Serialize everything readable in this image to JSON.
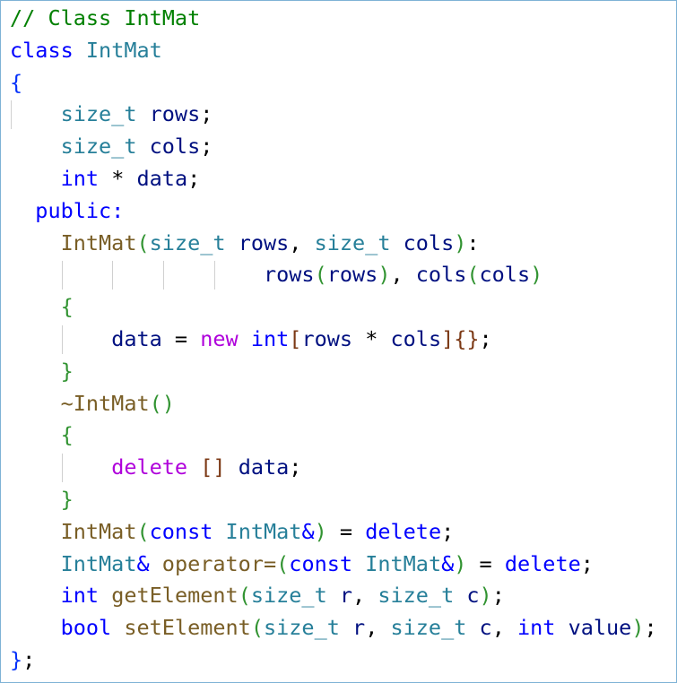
{
  "code_lines": [
    {
      "indent": 0,
      "guides": [],
      "tokens": [
        {
          "t": "// Class IntMat",
          "c": "comment"
        }
      ]
    },
    {
      "indent": 0,
      "guides": [],
      "tokens": [
        {
          "t": "class",
          "c": "kw"
        },
        {
          "t": " ",
          "c": "op"
        },
        {
          "t": "IntMat",
          "c": "type"
        }
      ]
    },
    {
      "indent": 0,
      "guides": [],
      "tokens": [
        {
          "t": "{",
          "c": "br1"
        }
      ]
    },
    {
      "indent": 4,
      "guides": [
        0
      ],
      "tokens": [
        {
          "t": "size_t",
          "c": "type"
        },
        {
          "t": " ",
          "c": "op"
        },
        {
          "t": "rows",
          "c": "var"
        },
        {
          "t": ";",
          "c": "op"
        }
      ]
    },
    {
      "indent": 4,
      "guides": [],
      "tokens": [
        {
          "t": "size_t",
          "c": "type"
        },
        {
          "t": " ",
          "c": "op"
        },
        {
          "t": "cols",
          "c": "var"
        },
        {
          "t": ";",
          "c": "op"
        }
      ]
    },
    {
      "indent": 4,
      "guides": [],
      "tokens": [
        {
          "t": "int",
          "c": "kw"
        },
        {
          "t": " * ",
          "c": "op"
        },
        {
          "t": "data",
          "c": "var"
        },
        {
          "t": ";",
          "c": "op"
        }
      ]
    },
    {
      "indent": 2,
      "guides": [],
      "tokens": [
        {
          "t": "public:",
          "c": "kw"
        }
      ]
    },
    {
      "indent": 4,
      "guides": [],
      "tokens": [
        {
          "t": "IntMat",
          "c": "fn"
        },
        {
          "t": "(",
          "c": "br2"
        },
        {
          "t": "size_t",
          "c": "type"
        },
        {
          "t": " ",
          "c": "op"
        },
        {
          "t": "rows",
          "c": "var"
        },
        {
          "t": ", ",
          "c": "op"
        },
        {
          "t": "size_t",
          "c": "type"
        },
        {
          "t": " ",
          "c": "op"
        },
        {
          "t": "cols",
          "c": "var"
        },
        {
          "t": ")",
          "c": "br2"
        },
        {
          "t": ":",
          "c": "op"
        }
      ]
    },
    {
      "indent": 20,
      "guides": [
        4,
        8,
        12,
        16
      ],
      "tokens": [
        {
          "t": "rows",
          "c": "var"
        },
        {
          "t": "(",
          "c": "br2"
        },
        {
          "t": "rows",
          "c": "var"
        },
        {
          "t": ")",
          "c": "br2"
        },
        {
          "t": ", ",
          "c": "op"
        },
        {
          "t": "cols",
          "c": "var"
        },
        {
          "t": "(",
          "c": "br2"
        },
        {
          "t": "cols",
          "c": "var"
        },
        {
          "t": ")",
          "c": "br2"
        }
      ]
    },
    {
      "indent": 4,
      "guides": [],
      "tokens": [
        {
          "t": "{",
          "c": "br2"
        }
      ]
    },
    {
      "indent": 8,
      "guides": [
        4
      ],
      "tokens": [
        {
          "t": "data",
          "c": "var"
        },
        {
          "t": " = ",
          "c": "op"
        },
        {
          "t": "new",
          "c": "ctrl"
        },
        {
          "t": " ",
          "c": "op"
        },
        {
          "t": "int",
          "c": "kw"
        },
        {
          "t": "[",
          "c": "br3"
        },
        {
          "t": "rows",
          "c": "var"
        },
        {
          "t": " * ",
          "c": "op"
        },
        {
          "t": "cols",
          "c": "var"
        },
        {
          "t": "]",
          "c": "br3"
        },
        {
          "t": "{}",
          "c": "br3"
        },
        {
          "t": ";",
          "c": "op"
        }
      ]
    },
    {
      "indent": 4,
      "guides": [],
      "tokens": [
        {
          "t": "}",
          "c": "br2"
        }
      ]
    },
    {
      "indent": 4,
      "guides": [],
      "tokens": [
        {
          "t": "~IntMat",
          "c": "fn"
        },
        {
          "t": "()",
          "c": "br2"
        }
      ]
    },
    {
      "indent": 4,
      "guides": [],
      "tokens": [
        {
          "t": "{",
          "c": "br2"
        }
      ]
    },
    {
      "indent": 8,
      "guides": [
        4
      ],
      "tokens": [
        {
          "t": "delete",
          "c": "ctrl"
        },
        {
          "t": " ",
          "c": "op"
        },
        {
          "t": "[]",
          "c": "br3"
        },
        {
          "t": " ",
          "c": "op"
        },
        {
          "t": "data",
          "c": "var"
        },
        {
          "t": ";",
          "c": "op"
        }
      ]
    },
    {
      "indent": 4,
      "guides": [],
      "tokens": [
        {
          "t": "}",
          "c": "br2"
        }
      ]
    },
    {
      "indent": 4,
      "guides": [],
      "tokens": [
        {
          "t": "IntMat",
          "c": "fn"
        },
        {
          "t": "(",
          "c": "br2"
        },
        {
          "t": "const",
          "c": "kw"
        },
        {
          "t": " ",
          "c": "op"
        },
        {
          "t": "IntMat",
          "c": "type"
        },
        {
          "t": "&",
          "c": "kw"
        },
        {
          "t": ")",
          "c": "br2"
        },
        {
          "t": " = ",
          "c": "op"
        },
        {
          "t": "delete",
          "c": "kw"
        },
        {
          "t": ";",
          "c": "op"
        }
      ]
    },
    {
      "indent": 4,
      "guides": [],
      "tokens": [
        {
          "t": "IntMat",
          "c": "type"
        },
        {
          "t": "&",
          "c": "kw"
        },
        {
          "t": " ",
          "c": "op"
        },
        {
          "t": "operator=",
          "c": "fn"
        },
        {
          "t": "(",
          "c": "br2"
        },
        {
          "t": "const",
          "c": "kw"
        },
        {
          "t": " ",
          "c": "op"
        },
        {
          "t": "IntMat",
          "c": "type"
        },
        {
          "t": "&",
          "c": "kw"
        },
        {
          "t": ")",
          "c": "br2"
        },
        {
          "t": " = ",
          "c": "op"
        },
        {
          "t": "delete",
          "c": "kw"
        },
        {
          "t": ";",
          "c": "op"
        }
      ]
    },
    {
      "indent": 4,
      "guides": [],
      "tokens": [
        {
          "t": "int",
          "c": "kw"
        },
        {
          "t": " ",
          "c": "op"
        },
        {
          "t": "getElement",
          "c": "fn"
        },
        {
          "t": "(",
          "c": "br2"
        },
        {
          "t": "size_t",
          "c": "type"
        },
        {
          "t": " ",
          "c": "op"
        },
        {
          "t": "r",
          "c": "var"
        },
        {
          "t": ", ",
          "c": "op"
        },
        {
          "t": "size_t",
          "c": "type"
        },
        {
          "t": " ",
          "c": "op"
        },
        {
          "t": "c",
          "c": "var"
        },
        {
          "t": ")",
          "c": "br2"
        },
        {
          "t": ";",
          "c": "op"
        }
      ]
    },
    {
      "indent": 4,
      "guides": [],
      "tokens": [
        {
          "t": "bool",
          "c": "kw"
        },
        {
          "t": " ",
          "c": "op"
        },
        {
          "t": "setElement",
          "c": "fn"
        },
        {
          "t": "(",
          "c": "br2"
        },
        {
          "t": "size_t",
          "c": "type"
        },
        {
          "t": " ",
          "c": "op"
        },
        {
          "t": "r",
          "c": "var"
        },
        {
          "t": ", ",
          "c": "op"
        },
        {
          "t": "size_t",
          "c": "type"
        },
        {
          "t": " ",
          "c": "op"
        },
        {
          "t": "c",
          "c": "var"
        },
        {
          "t": ", ",
          "c": "op"
        },
        {
          "t": "int",
          "c": "kw"
        },
        {
          "t": " ",
          "c": "op"
        },
        {
          "t": "value",
          "c": "var"
        },
        {
          "t": ")",
          "c": "br2"
        },
        {
          "t": ";",
          "c": "op"
        }
      ]
    },
    {
      "indent": 0,
      "guides": [],
      "tokens": [
        {
          "t": "}",
          "c": "br1"
        },
        {
          "t": ";",
          "c": "op"
        }
      ]
    }
  ],
  "colors": {
    "comment": "#008000",
    "keyword": "#0000ff",
    "type": "#267f99",
    "function": "#795e26",
    "control": "#af00db",
    "variable": "#001080",
    "bracket_level1": "#0431fa",
    "bracket_level2": "#319331",
    "bracket_level3": "#7b3814",
    "frame_border": "#7fb2d6"
  }
}
